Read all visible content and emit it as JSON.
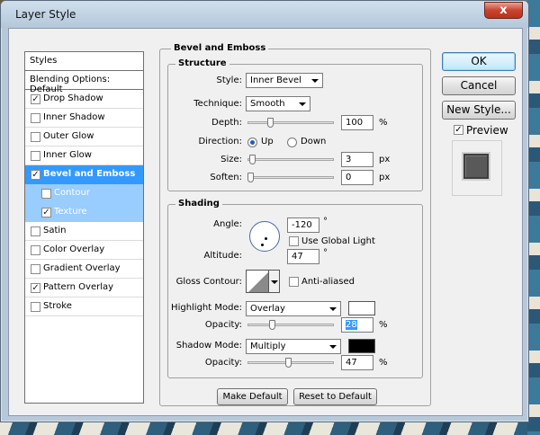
{
  "window": {
    "title": "Layer Style",
    "close_label": "x"
  },
  "styles_panel": {
    "header": "Styles",
    "blending": "Blending Options: Default",
    "items": [
      {
        "label": "Drop Shadow",
        "checked": true
      },
      {
        "label": "Inner Shadow",
        "checked": false
      },
      {
        "label": "Outer Glow",
        "checked": false
      },
      {
        "label": "Inner Glow",
        "checked": false
      },
      {
        "label": "Bevel and Emboss",
        "checked": true,
        "selected": true
      },
      {
        "label": "Contour",
        "checked": false,
        "sub": true
      },
      {
        "label": "Texture",
        "checked": true,
        "sub": true
      },
      {
        "label": "Satin",
        "checked": false
      },
      {
        "label": "Color Overlay",
        "checked": false
      },
      {
        "label": "Gradient Overlay",
        "checked": false
      },
      {
        "label": "Pattern Overlay",
        "checked": true
      },
      {
        "label": "Stroke",
        "checked": false
      }
    ]
  },
  "bevel": {
    "title": "Bevel and Emboss",
    "structure": {
      "title": "Structure",
      "style_label": "Style:",
      "style_value": "Inner Bevel",
      "technique_label": "Technique:",
      "technique_value": "Smooth",
      "depth_label": "Depth:",
      "depth_value": "100",
      "depth_unit": "%",
      "direction_label": "Direction:",
      "up_label": "Up",
      "down_label": "Down",
      "size_label": "Size:",
      "size_value": "3",
      "size_unit": "px",
      "soften_label": "Soften:",
      "soften_value": "0",
      "soften_unit": "px"
    },
    "shading": {
      "title": "Shading",
      "angle_label": "Angle:",
      "angle_value": "-120",
      "angle_unit": "°",
      "global_light_label": "Use Global Light",
      "altitude_label": "Altitude:",
      "altitude_value": "47",
      "altitude_unit": "°",
      "gloss_label": "Gloss Contour:",
      "antialiased_label": "Anti-aliased",
      "highlight_label": "Highlight Mode:",
      "highlight_value": "Overlay",
      "highlight_color": "#ffffff",
      "h_opacity_label": "Opacity:",
      "h_opacity_value": "28",
      "h_opacity_unit": "%",
      "shadow_label": "Shadow Mode:",
      "shadow_value": "Multiply",
      "shadow_color": "#000000",
      "s_opacity_label": "Opacity:",
      "s_opacity_value": "47",
      "s_opacity_unit": "%"
    },
    "make_default": "Make Default",
    "reset_default": "Reset to Default"
  },
  "buttons": {
    "ok": "OK",
    "cancel": "Cancel",
    "new_style": "New Style...",
    "preview": "Preview"
  }
}
